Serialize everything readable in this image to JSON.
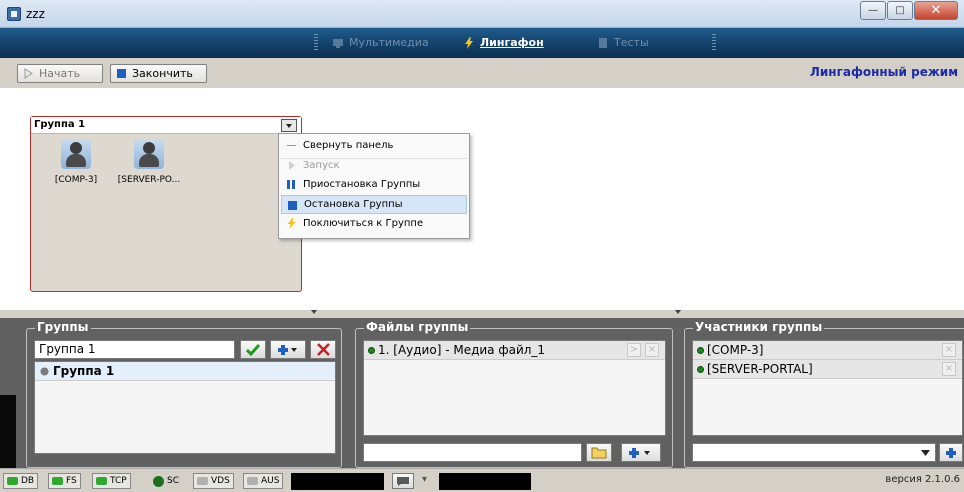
{
  "window": {
    "title": "zzz"
  },
  "nav": {
    "items": [
      {
        "label": "Мультимедиа",
        "active": false
      },
      {
        "label": "Лингафон",
        "active": true
      },
      {
        "label": "Тесты",
        "active": false
      }
    ]
  },
  "toolbar": {
    "start_label": "Начать",
    "stop_label": "Закончить",
    "mode_label": "Лингафонный режим"
  },
  "group_panel": {
    "name": "Группа 1",
    "members": [
      "[COMP-3]",
      "[SERVER-PO..."
    ]
  },
  "context_menu": {
    "items": [
      {
        "label": "Свернуть панель",
        "icon": "minus-icon",
        "disabled": false
      },
      {
        "label": "Запуск",
        "icon": "play-icon",
        "disabled": true
      },
      {
        "label": "Приостановка Группы",
        "icon": "pause-icon",
        "disabled": false
      },
      {
        "label": "Остановка Группы",
        "icon": "stop-icon",
        "disabled": false,
        "selected": true
      },
      {
        "label": "Поключиться к Группе",
        "icon": "lightning-icon",
        "disabled": false
      }
    ]
  },
  "groups_panel": {
    "legend": "Группы",
    "input_value": "Группа 1",
    "list": [
      "Группа 1"
    ]
  },
  "files_panel": {
    "legend": "Файлы группы",
    "list": [
      "1. [Аудио] - Медиа файл_1"
    ]
  },
  "participants_panel": {
    "legend": "Участники группы",
    "list": [
      "[COMP-3]",
      "[SERVER-PORTAL]"
    ]
  },
  "status": {
    "indicators": [
      {
        "label": "DB",
        "color": "#2fa82f"
      },
      {
        "label": "FS",
        "color": "#2fa82f"
      },
      {
        "label": "TCP",
        "color": "#2fa82f"
      },
      {
        "label": "SC",
        "color": "#1d6e1d"
      },
      {
        "label": "VDS",
        "color": "#b0b0b0"
      },
      {
        "label": "AUS",
        "color": "#b0b0b0"
      }
    ],
    "version": "версия 2.1.0.6"
  }
}
